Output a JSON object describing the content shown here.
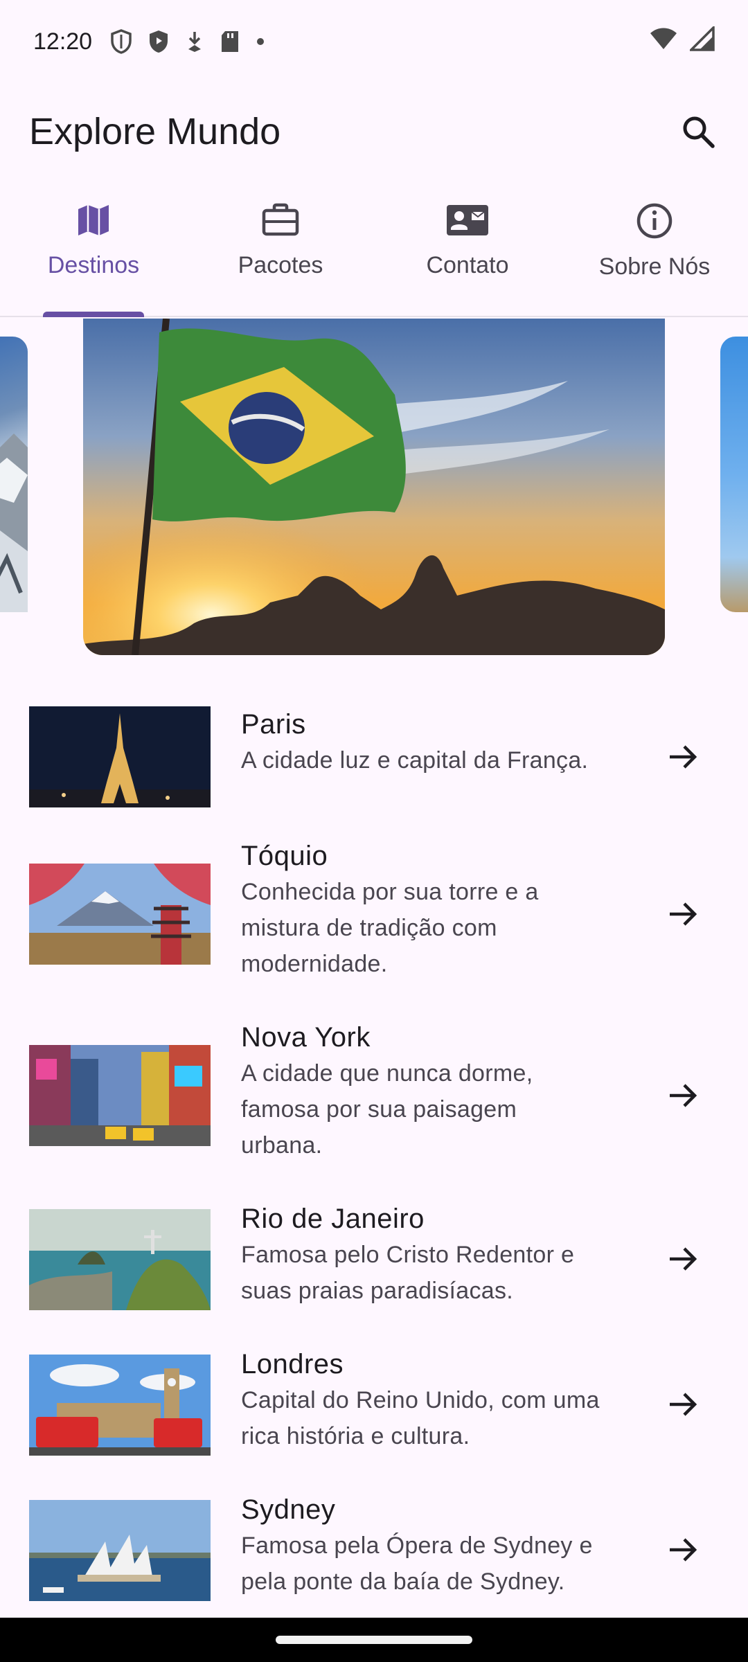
{
  "status_bar": {
    "time": "12:20",
    "left_icons": [
      "shield-outline-icon",
      "shield-play-icon",
      "download-icon",
      "sd-card-icon",
      "dot-icon"
    ],
    "right_icons": [
      "wifi-icon",
      "signal-icon"
    ]
  },
  "app_bar": {
    "title": "Explore Mundo",
    "search_icon": "search-icon"
  },
  "tabs": [
    {
      "label": "Destinos",
      "icon": "map-icon",
      "active": true
    },
    {
      "label": "Pacotes",
      "icon": "briefcase-icon",
      "active": false
    },
    {
      "label": "Contato",
      "icon": "contact-card-icon",
      "active": false
    },
    {
      "label": "Sobre Nós",
      "icon": "info-icon",
      "active": false
    }
  ],
  "carousel": {
    "images": [
      "mountain-snow-image",
      "brazil-flag-sunset-image",
      "sky-statue-image"
    ]
  },
  "destinations": [
    {
      "title": "Paris",
      "desc": [
        "A cidade luz e capital da França."
      ],
      "thumb": "eiffel-tower-night"
    },
    {
      "title": "Tóquio",
      "desc": [
        "Conhecida por sua torre e a",
        "mistura de tradição com",
        "modernidade."
      ],
      "thumb": "mount-fuji-pagoda"
    },
    {
      "title": "Nova York",
      "desc": [
        "A cidade que nunca dorme,",
        "famosa por sua paisagem",
        "urbana."
      ],
      "thumb": "times-square"
    },
    {
      "title": "Rio de Janeiro",
      "desc": [
        "Famosa pelo Cristo Redentor e",
        "suas praias paradisíacas."
      ],
      "thumb": "christ-redeemer-bay"
    },
    {
      "title": "Londres",
      "desc": [
        "Capital do Reino Unido, com uma",
        "rica história e cultura."
      ],
      "thumb": "big-ben-buses"
    },
    {
      "title": "Sydney",
      "desc": [
        "Famosa pela Ópera de Sydney e",
        "pela ponte da baía de Sydney."
      ],
      "thumb": "sydney-opera-house"
    }
  ],
  "colors": {
    "accent": "#6750a4",
    "background": "#fef7ff",
    "text_primary": "#1d1b20",
    "text_secondary": "#49454f"
  }
}
